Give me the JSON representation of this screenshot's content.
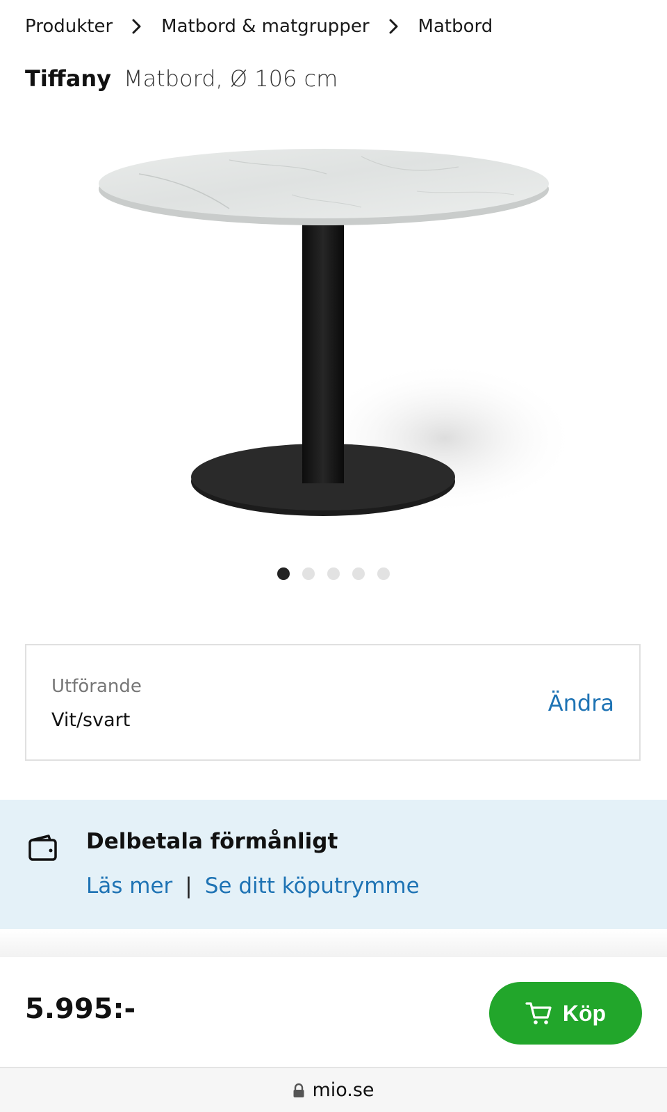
{
  "breadcrumb": {
    "items": [
      "Produkter",
      "Matbord & matgrupper",
      "Matbord"
    ]
  },
  "product": {
    "name": "Tiffany",
    "subtitle": "Matbord, Ø 106 cm"
  },
  "gallery": {
    "image_count": 5,
    "active_index": 0
  },
  "variant": {
    "label": "Utförande",
    "value": "Vit/svart",
    "change_label": "Ändra"
  },
  "financing": {
    "title": "Delbetala förmånligt",
    "link_read_more": "Läs mer",
    "separator": "|",
    "link_credit": "Se ditt köputrymme"
  },
  "purchase": {
    "price": "5.995:-",
    "buy_label": "Köp"
  },
  "browser": {
    "url": "mio.se"
  },
  "icons": {
    "breadcrumb_separator": "chevron-right-icon",
    "financing": "wallet-icon",
    "buy": "cart-icon",
    "url": "lock-icon"
  },
  "colors": {
    "link": "#1e73b4",
    "buy_button": "#22a62b",
    "financing_bg": "#e4f1f8",
    "dot_active": "#222222",
    "dot_inactive": "#e2e2e2"
  }
}
